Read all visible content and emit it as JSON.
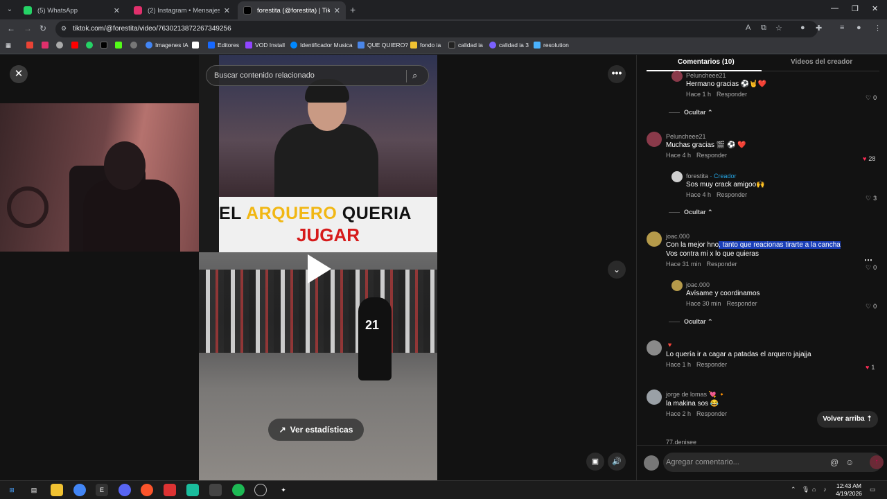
{
  "browser": {
    "tabs": [
      {
        "label": "(5) WhatsApp",
        "color": "#25d366"
      },
      {
        "label": "(2) Instagram • Mensajes",
        "color": "#e1306c"
      },
      {
        "label": "forestita (@forestita) | TikTok",
        "color": "#000000"
      }
    ],
    "url": "tiktok.com/@forestita/video/7630213872267349256",
    "bookmarks": [
      {
        "label": "Imagenes IA"
      },
      {
        "label": "Editores"
      },
      {
        "label": "VOD Install"
      },
      {
        "label": "Identificador Musica"
      },
      {
        "label": "QUE QUIERO?"
      },
      {
        "label": "fondo ia"
      },
      {
        "label": "calidad ia"
      },
      {
        "label": "calidad ia 3"
      },
      {
        "label": "resolution"
      }
    ]
  },
  "player": {
    "search_placeholder": "Buscar contenido relacionado",
    "caption_line1_a": "EL ",
    "caption_line1_b": "ARQUERO",
    "caption_line1_c": " QUERIA",
    "caption_line2": "JUGAR",
    "jersey_number": "21",
    "stats_label": "Ver estadísticas"
  },
  "comments_panel": {
    "tab_comments": "Comentarios (10)",
    "tab_videos": "Videos del creador",
    "comments": [
      {
        "user": "Peluncheee21",
        "text": "Hermano gracias ⚽🤘❤️",
        "time": "Hace 1 h",
        "reply": "Responder",
        "likes": "0"
      },
      {
        "hide": "Ocultar ⌃"
      },
      {
        "user": "Peluncheee21",
        "text": "Muchas gracias 🎬 ⚽ ❤️",
        "time": "Hace 4 h",
        "reply": "Responder",
        "likes": "28"
      },
      {
        "user": "forestita",
        "creator": " · Creador",
        "text": "Sos muy crack amigoo🙌",
        "time": "Hace 4 h",
        "reply": "Responder",
        "likes": "3"
      },
      {
        "hide": "Ocultar ⌃"
      },
      {
        "user": "joac.000",
        "text_a": "Con la mejor hno",
        "text_b": ", tanto que reacionas tirarte a la cancha",
        "text2": "Vos contra mi x lo que quieras",
        "time": "Hace 31 min",
        "reply": "Responder",
        "likes": "0"
      },
      {
        "user": "joac.000",
        "text": "Avísame y coordinamos",
        "time": "Hace 30 min",
        "reply": "Responder",
        "likes": "0"
      },
      {
        "hide": "Ocultar ⌃"
      },
      {
        "user": "🔻",
        "text": "Lo quería ir a cagar a patadas el arquero jajajja",
        "time": "Hace 1 h",
        "reply": "Responder",
        "likes": "1"
      },
      {
        "user": "jorge de lomas 💘 🔸",
        "text": "la makina sos 😂",
        "time": "Hace 2 h",
        "reply": "Responder"
      },
      {
        "user": "77.denisee"
      }
    ],
    "volver": "Volver arriba ⇡",
    "add_comment_placeholder": "Agregar comentario..."
  },
  "taskbar": {
    "time": "12:43 AM",
    "date": "4/19/2026"
  }
}
